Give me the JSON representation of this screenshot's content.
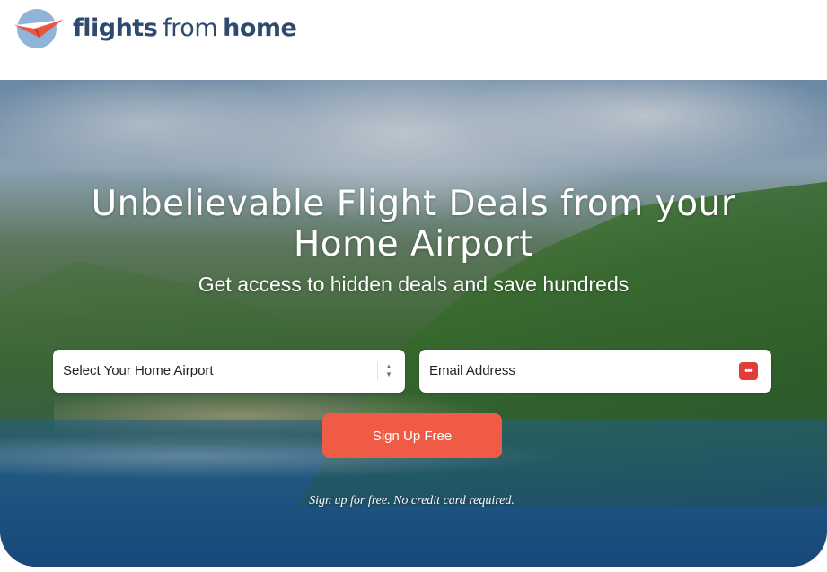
{
  "header": {
    "logo_word1": "flights",
    "logo_word2": "from",
    "logo_word3": "home",
    "logo_icon": "paper-plane-icon"
  },
  "hero": {
    "headline": "Unbelievable Flight Deals from your Home Airport",
    "subheadline": "Get access to hidden deals and save hundreds",
    "airport_select": {
      "selected_value": "Select Your Home Airport",
      "icon": "select-arrows-icon"
    },
    "email_field": {
      "placeholder": "Email Address",
      "icon": "password-manager-icon"
    },
    "signup_label": "Sign Up Free",
    "note": "Sign up for free. No credit card required."
  },
  "colors": {
    "brand_text": "#2e4a6e",
    "cta": "#ef5b44",
    "logo_circle": "#8fb3d9",
    "logo_plane": "#e8563d"
  }
}
